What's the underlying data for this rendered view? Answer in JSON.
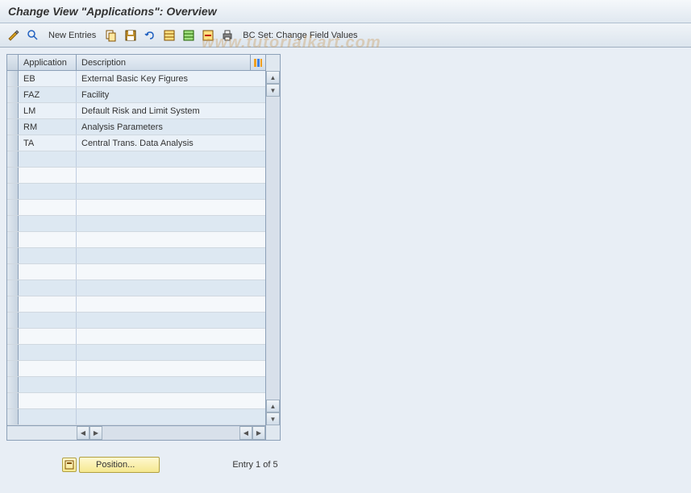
{
  "title": "Change View \"Applications\": Overview",
  "toolbar": {
    "new_entries_label": "New Entries",
    "bc_set_label": "BC Set: Change Field Values"
  },
  "table": {
    "columns": {
      "application": "Application",
      "description": "Description"
    },
    "rows": [
      {
        "app": "EB",
        "desc": "External Basic Key Figures"
      },
      {
        "app": "FAZ",
        "desc": "Facility"
      },
      {
        "app": "LM",
        "desc": "Default Risk and Limit System"
      },
      {
        "app": "RM",
        "desc": "Analysis Parameters"
      },
      {
        "app": "TA",
        "desc": "Central Trans. Data Analysis"
      }
    ],
    "empty_row_count": 17
  },
  "footer": {
    "position_label": "Position...",
    "entry_status": "Entry 1 of 5"
  },
  "watermark": "www.tutorialkart.com"
}
